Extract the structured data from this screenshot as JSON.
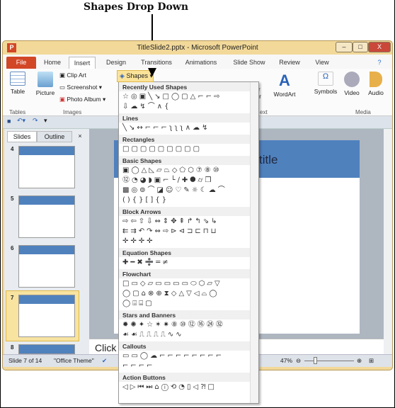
{
  "caption": "Shapes Drop Down",
  "window": {
    "title": "TitleSlide2.pptx - Microsoft PowerPoint",
    "app_icon": "P",
    "min": "–",
    "max": "□",
    "close": "X"
  },
  "tabs": [
    "File",
    "Home",
    "Insert",
    "Design",
    "Transitions",
    "Animations",
    "Slide Show",
    "Review",
    "View"
  ],
  "active_tab": "Insert",
  "ribbon": {
    "table": "Table",
    "picture": "Picture",
    "clip_art": "Clip Art",
    "screenshot": "Screenshot ▾",
    "photo_album": "Photo Album ▾",
    "shapes": "Shapes ▾",
    "header_footer_partial": "er",
    "header_footer_partial2": "ter",
    "wordart": "WordArt",
    "symbols": "Symbols",
    "video": "Video",
    "audio": "Audio",
    "groups": {
      "tables": "Tables",
      "images": "Images",
      "text_partial": "ext",
      "media": "Media"
    }
  },
  "slides_pane": {
    "tabs": [
      "Slides",
      "Outline"
    ],
    "close": "×",
    "slides": [
      "4",
      "5",
      "6",
      "7",
      "8"
    ],
    "selected": "7"
  },
  "slide": {
    "title_partial": "title"
  },
  "notes_partial": "Click t",
  "status": {
    "slide": "Slide 7 of 14",
    "theme": "\"Office Theme\"",
    "zoom": "47%",
    "zoom_value": 47
  },
  "shapes_menu": [
    {
      "title": "Recently Used Shapes",
      "rows": [
        "☆◎▣╲↘□◯▢△⌐⌐⇨",
        "⇩☁↯⌒∧{"
      ]
    },
    {
      "title": "Lines",
      "rows": [
        "╲↘↔⌐⌐⌐ʅʅʅ∧☁↯"
      ]
    },
    {
      "title": "Rectangles",
      "rows": [
        "□▢▢▢▢▢▢▢▢"
      ]
    },
    {
      "title": "Basic Shapes",
      "rows": [
        "▣◯△◺▱⏢◇⬠⬡⑦⑧⑩",
        "⑫◔◕◗▣⌐└∕✚⯃⌭❒",
        "▩◎⊚⌒◪☺♡✎☼☾☁⌒",
        "(){}[]{}"
      ]
    },
    {
      "title": "Block Arrows",
      "rows": [
        "⇨⇦⇧⇩⇔⇕✥⇞↱↰⇘↳",
        "⇇⇉↶↷⇔⇨⊳⊲⊐⊏⊓⊔",
        "✛✛✛✛"
      ]
    },
    {
      "title": "Equation Shapes",
      "rows": [
        "✚━✖➗═≠"
      ]
    },
    {
      "title": "Flowchart",
      "rows": [
        "□▭◇▱▭▭▭▭⬭⬡▱▽",
        "◯▢⌂⊗⊕⧗◇△▽◁⌓◯",
        "◯⌹⌸▢"
      ]
    },
    {
      "title": "Stars and Banners",
      "rows": [
        "✹✺✦☆✶✷⑧⑩⑫⑯㉔㉜",
        "☙☙⎍⎍⎍⎍∿∿"
      ]
    },
    {
      "title": "Callouts",
      "rows": [
        "▭▭◯☁⌐⌐⌐⌐⌐⌐⌐⌐",
        "⌐⌐⌐⌐"
      ]
    },
    {
      "title": "Action Buttons",
      "rows": [
        "◁▷⏮⏭⌂ⓘ⟲◔▯◁⁈□"
      ]
    }
  ]
}
